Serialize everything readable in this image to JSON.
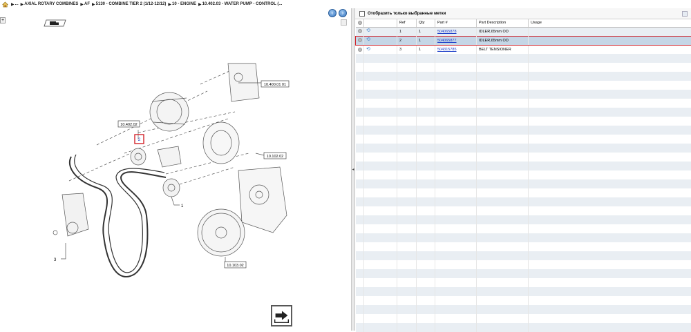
{
  "breadcrumb": {
    "items": [
      "...",
      "AXIAL ROTARY COMBINES",
      "AF",
      "5130 - COMBINE TIER 2 (1/12-12/12)",
      "10 - ENGINE",
      "10.402.03 - WATER PUMP - CONTROL (..."
    ]
  },
  "diagram": {
    "callouts": {
      "c1": "10.400.01 01",
      "c2": "10.402.02",
      "c3": "10.102.02",
      "c4": "10.103.02",
      "ref1": "1",
      "ref2": "2",
      "ref3": "3"
    }
  },
  "parts": {
    "filter_label": "Отобразить только выбранные метки",
    "columns": [
      "Ref",
      "Qty",
      "Part #",
      "Part Description",
      "Usage"
    ],
    "rows": [
      {
        "ref": "1",
        "qty": "1",
        "part": "504065878",
        "desc": "IDLER,65mm OD",
        "usage": ""
      },
      {
        "ref": "2",
        "qty": "1",
        "part": "504065877",
        "desc": "IDLER,65mm OD",
        "usage": ""
      },
      {
        "ref": "3",
        "qty": "1",
        "part": "504315785",
        "desc": "BELT TENSIONER",
        "usage": ""
      }
    ]
  },
  "colors": {
    "selection_border": "#d2232a",
    "selected_row": "#c5d6e6",
    "link": "#1a3cc8"
  }
}
